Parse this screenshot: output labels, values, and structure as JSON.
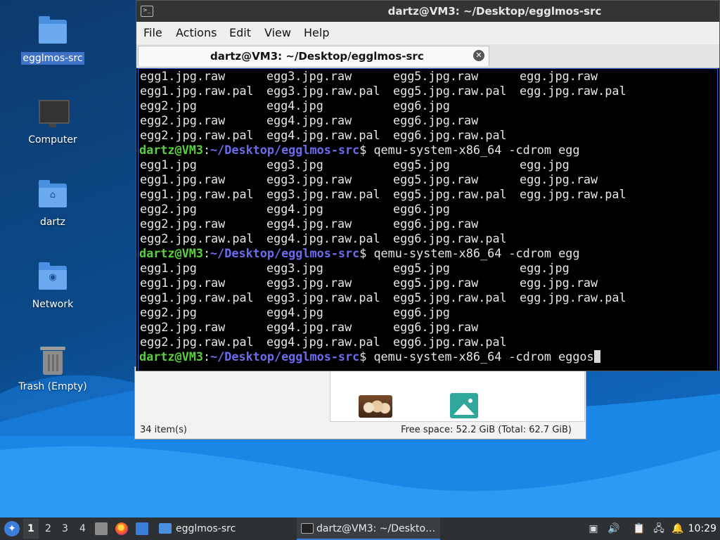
{
  "desktop": {
    "icons": [
      {
        "label": "egglmos-src",
        "icon": "folder-icon"
      },
      {
        "label": "Computer",
        "icon": "computer-icon"
      },
      {
        "label": "dartz",
        "icon": "home-folder-icon"
      },
      {
        "label": "Network",
        "icon": "network-folder-icon"
      },
      {
        "label": "Trash (Empty)",
        "icon": "trash-icon"
      }
    ]
  },
  "file_manager": {
    "status_left": "34 item(s)",
    "status_right": "Free space: 52.2 GiB (Total: 62.7 GiB)"
  },
  "terminal": {
    "title": "dartz@VM3: ~/Desktop/egglmos-src",
    "menu": [
      "File",
      "Actions",
      "Edit",
      "View",
      "Help"
    ],
    "tab_label": "dartz@VM3: ~/Desktop/egglmos-src",
    "prompt_user": "dartz@VM3",
    "prompt_sep": ":",
    "prompt_path": "~/Desktop/egglmos-src",
    "prompt_end": "$ ",
    "lines": [
      {
        "type": "files",
        "cols": [
          "egg1.jpg.raw",
          "egg3.jpg.raw",
          "egg5.jpg.raw",
          "egg.jpg.raw"
        ]
      },
      {
        "type": "files",
        "cols": [
          "egg1.jpg.raw.pal",
          "egg3.jpg.raw.pal",
          "egg5.jpg.raw.pal",
          "egg.jpg.raw.pal"
        ]
      },
      {
        "type": "files",
        "cols": [
          "egg2.jpg",
          "egg4.jpg",
          "egg6.jpg",
          ""
        ]
      },
      {
        "type": "files",
        "cols": [
          "egg2.jpg.raw",
          "egg4.jpg.raw",
          "egg6.jpg.raw",
          ""
        ]
      },
      {
        "type": "files",
        "cols": [
          "egg2.jpg.raw.pal",
          "egg4.jpg.raw.pal",
          "egg6.jpg.raw.pal",
          ""
        ]
      },
      {
        "type": "prompt",
        "command": "qemu-system-x86_64 -cdrom egg"
      },
      {
        "type": "files",
        "cols": [
          "egg1.jpg",
          "egg3.jpg",
          "egg5.jpg",
          "egg.jpg"
        ]
      },
      {
        "type": "files",
        "cols": [
          "egg1.jpg.raw",
          "egg3.jpg.raw",
          "egg5.jpg.raw",
          "egg.jpg.raw"
        ]
      },
      {
        "type": "files",
        "cols": [
          "egg1.jpg.raw.pal",
          "egg3.jpg.raw.pal",
          "egg5.jpg.raw.pal",
          "egg.jpg.raw.pal"
        ]
      },
      {
        "type": "files",
        "cols": [
          "egg2.jpg",
          "egg4.jpg",
          "egg6.jpg",
          ""
        ]
      },
      {
        "type": "files",
        "cols": [
          "egg2.jpg.raw",
          "egg4.jpg.raw",
          "egg6.jpg.raw",
          ""
        ]
      },
      {
        "type": "files",
        "cols": [
          "egg2.jpg.raw.pal",
          "egg4.jpg.raw.pal",
          "egg6.jpg.raw.pal",
          ""
        ]
      },
      {
        "type": "prompt",
        "command": "qemu-system-x86_64 -cdrom egg"
      },
      {
        "type": "files",
        "cols": [
          "egg1.jpg",
          "egg3.jpg",
          "egg5.jpg",
          "egg.jpg"
        ]
      },
      {
        "type": "files",
        "cols": [
          "egg1.jpg.raw",
          "egg3.jpg.raw",
          "egg5.jpg.raw",
          "egg.jpg.raw"
        ]
      },
      {
        "type": "files",
        "cols": [
          "egg1.jpg.raw.pal",
          "egg3.jpg.raw.pal",
          "egg5.jpg.raw.pal",
          "egg.jpg.raw.pal"
        ]
      },
      {
        "type": "files",
        "cols": [
          "egg2.jpg",
          "egg4.jpg",
          "egg6.jpg",
          ""
        ]
      },
      {
        "type": "files",
        "cols": [
          "egg2.jpg.raw",
          "egg4.jpg.raw",
          "egg6.jpg.raw",
          ""
        ]
      },
      {
        "type": "files",
        "cols": [
          "egg2.jpg.raw.pal",
          "egg4.jpg.raw.pal",
          "egg6.jpg.raw.pal",
          ""
        ]
      },
      {
        "type": "prompt",
        "command": "qemu-system-x86_64 -cdrom eggos",
        "cursor": true
      }
    ]
  },
  "taskbar": {
    "workspaces": [
      "1",
      "2",
      "3",
      "4"
    ],
    "active_workspace": "1",
    "launchers": [
      "file-manager-icon",
      "firefox-icon",
      "show-desktop-icon"
    ],
    "tasks": [
      {
        "label": "egglmos-src",
        "icon": "folder-icon",
        "active": false
      },
      {
        "label": "dartz@VM3: ~/Deskto…",
        "icon": "terminal-icon",
        "active": true
      }
    ],
    "tray": [
      "media-icon",
      "volume-icon",
      "clipboard-icon",
      "network-icon",
      "notification-icon"
    ],
    "clock": "10:29"
  },
  "colors": {
    "prompt_user": "#5ccf3c",
    "prompt_path": "#6c6cf0",
    "accent": "#3b7dd8"
  }
}
